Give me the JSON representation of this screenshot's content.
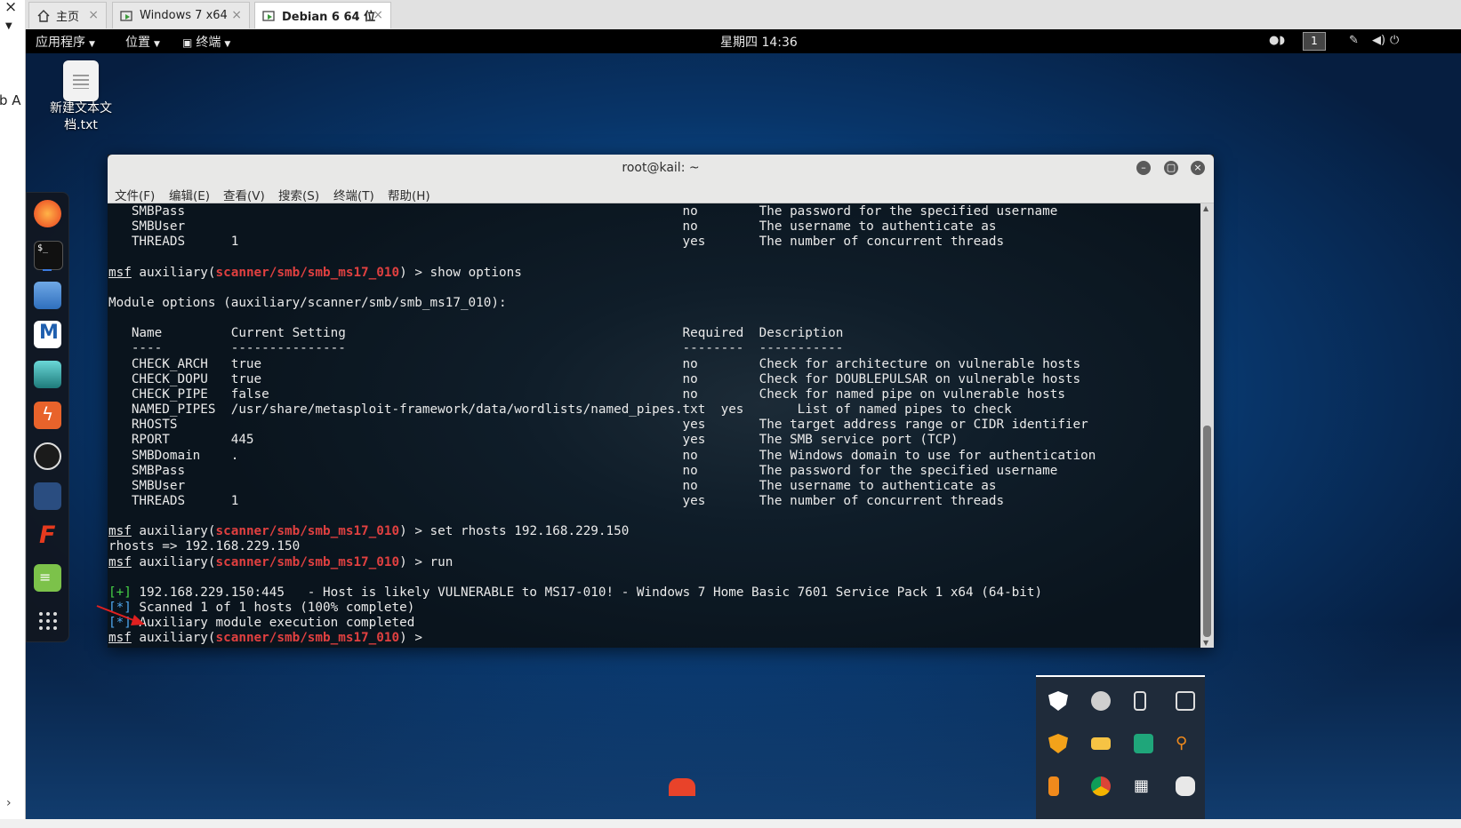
{
  "host": {
    "left_strip": {
      "close": "×",
      "text": "b A"
    },
    "tabs": [
      {
        "label": "主页",
        "icon": "home-icon",
        "active": false
      },
      {
        "label": "Windows 7 x64",
        "icon": "vm-icon",
        "active": false
      },
      {
        "label": "Debian 6 64 位",
        "icon": "vm-icon",
        "active": true
      }
    ],
    "tab_close": "×"
  },
  "topbar": {
    "menus": [
      "应用程序",
      "位置",
      "终端"
    ],
    "clock": "星期四 14:36",
    "workspace": "1"
  },
  "desktop_icon": {
    "label": "新建文本文档.txt"
  },
  "dock": {
    "items": [
      "firefox-icon",
      "terminal-icon",
      "files-icon",
      "metasploit-icon",
      "armitage-icon",
      "burpsuite-icon",
      "maltego-icon",
      "beef-icon",
      "faraday-icon",
      "leafpad-icon",
      "show-apps-icon"
    ]
  },
  "terminal": {
    "title": "root@kail: ~",
    "menu": [
      "文件(F)",
      "编辑(E)",
      "查看(V)",
      "搜索(S)",
      "终端(T)",
      "帮助(H)"
    ],
    "lines": {
      "l1": "   SMBPass                                                                 no        The password for the specified username",
      "l2": "   SMBUser                                                                 no        The username to authenticate as",
      "l3": "   THREADS      1                                                          yes       The number of concurrent threads",
      "prompt_msf": "msf",
      "prompt_aux_open": " auxiliary(",
      "prompt_module": "scanner/smb/smb_ms17_010",
      "prompt_close": ") > ",
      "cmd1": "show options",
      "l5": "Module options (auxiliary/scanner/smb/smb_ms17_010):",
      "h1": "   Name         Current Setting                                            Required  Description",
      "h2": "   ----         ---------------                                            --------  -----------",
      "o1": "   CHECK_ARCH   true                                                       no        Check for architecture on vulnerable hosts",
      "o2": "   CHECK_DOPU   true                                                       no        Check for DOUBLEPULSAR on vulnerable hosts",
      "o3": "   CHECK_PIPE   false                                                      no        Check for named pipe on vulnerable hosts",
      "o4": "   NAMED_PIPES  /usr/share/metasploit-framework/data/wordlists/named_pipes.txt  yes       List of named pipes to check",
      "o5": "   RHOSTS                                                                  yes       The target address range or CIDR identifier",
      "o6": "   RPORT        445                                                        yes       The SMB service port (TCP)",
      "o7": "   SMBDomain    .                                                          no        The Windows domain to use for authentication",
      "o8": "   SMBPass                                                                 no        The password for the specified username",
      "o9": "   SMBUser                                                                 no        The username to authenticate as",
      "o10": "   THREADS      1                                                          yes       The number of concurrent threads",
      "cmd2": "set rhosts 192.168.229.150",
      "r1": "rhosts => 192.168.229.150",
      "cmd3": "run",
      "plus": "[+]",
      "res1": " 192.168.229.150:445   - Host is likely VULNERABLE to MS17-010! - Windows 7 Home Basic 7601 Service Pack 1 x64 (64-bit)",
      "star": "[*]",
      "res2": " Scanned 1 of 1 hosts (100% complete)",
      "res3": " Auxiliary module execution completed"
    }
  },
  "tray_popup": {
    "icons": [
      "shield-check-icon",
      "pin-icon",
      "usb-icon",
      "vm-tray-icon",
      "security-icon",
      "card-icon",
      "wox-icon",
      "search-tray-icon",
      "usb-drive-icon",
      "chrome-icon",
      "grid-icon",
      "cloud-icon"
    ]
  },
  "colors": {
    "module": "#e04040",
    "plus": "#46d246",
    "star": "#4fa8f0",
    "arrow": "#e02020"
  }
}
